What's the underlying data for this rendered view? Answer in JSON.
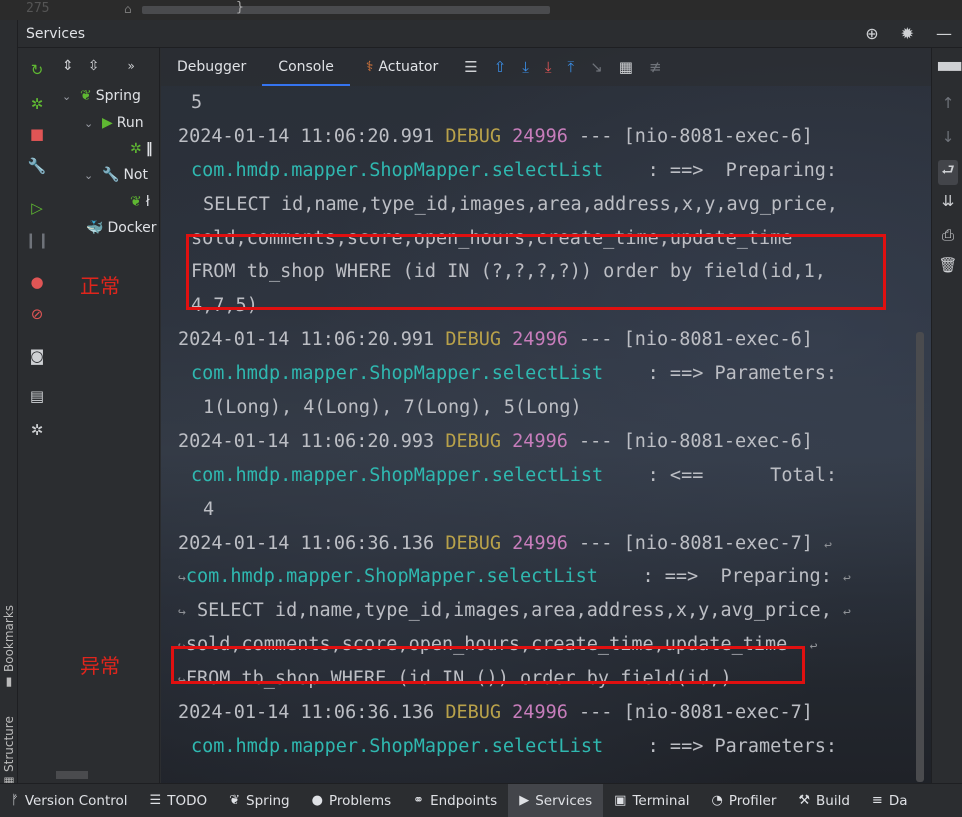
{
  "editor": {
    "line_number": "275",
    "brace": "}"
  },
  "window": {
    "title": "Services"
  },
  "left_stripe": {
    "bookmarks": "Bookmarks",
    "structure": "Structure"
  },
  "tree": {
    "items": [
      {
        "label": "Spring",
        "arrow": "⌄"
      },
      {
        "label": "Run",
        "arrow": "⌄"
      },
      {
        "label": "Not",
        "arrow": "⌄"
      },
      {
        "label": "Docker"
      }
    ]
  },
  "console": {
    "tabs": [
      "Debugger",
      "Console",
      "Actuator"
    ],
    "active_tab": "Console",
    "lines": [
      {
        "indent": "ind",
        "text": "5"
      },
      {
        "ts": "2024-01-14 11:06:20.991",
        "level": "DEBUG",
        "pid": "24996",
        "sep": "---",
        "thread": "[nio-8081-exec-6]"
      },
      {
        "logger": "com.hmdp.mapper.ShopMapper.selectList",
        "msg": "    : ==>  Preparing:"
      },
      {
        "indent": "ind2",
        "text": "SELECT id,name,type_id,images,area,address,x,y,avg_price,"
      },
      {
        "indent": "ind",
        "text": "sold,comments,score,open_hours,create_time,update_time"
      },
      {
        "indent": "ind",
        "text": "FROM tb_shop WHERE (id IN (?,?,?,?)) order by field(id,1,"
      },
      {
        "indent": "ind",
        "text": "4,7,5)"
      },
      {
        "ts": "2024-01-14 11:06:20.991",
        "level": "DEBUG",
        "pid": "24996",
        "sep": "---",
        "thread": "[nio-8081-exec-6]"
      },
      {
        "logger": "com.hmdp.mapper.ShopMapper.selectList",
        "msg": "    : ==> Parameters:"
      },
      {
        "indent": "ind2",
        "text": "1(Long), 4(Long), 7(Long), 5(Long)"
      },
      {
        "ts": "2024-01-14 11:06:20.993",
        "level": "DEBUG",
        "pid": "24996",
        "sep": "---",
        "thread": "[nio-8081-exec-6]"
      },
      {
        "logger": "com.hmdp.mapper.ShopMapper.selectList",
        "msg": "    : <==      Total:"
      },
      {
        "indent": "ind2",
        "text": "4"
      },
      {
        "ts": "2024-01-14 11:06:36.136",
        "level": "DEBUG",
        "pid": "24996",
        "sep": "---",
        "thread": "[nio-8081-exec-7]",
        "wrap_end": "↩"
      },
      {
        "wrap_start": "↪",
        "logger": "com.hmdp.mapper.ShopMapper.selectList",
        "msg": "    : ==>  Preparing:",
        "wrap_end": "↩"
      },
      {
        "wrap_start": "↪",
        "text": " SELECT id,name,type_id,images,area,address,x,y,avg_price,",
        "wrap_end": "↩"
      },
      {
        "wrap_start": "↪",
        "text": "sold,comments,score,open_hours,create_time,update_time ",
        "wrap_end": "↩"
      },
      {
        "wrap_start": "↪",
        "text": "FROM tb_shop WHERE (id IN ()) order by field(id,)"
      },
      {
        "ts": "2024-01-14 11:06:36.136",
        "level": "DEBUG",
        "pid": "24996",
        "sep": "---",
        "thread": "[nio-8081-exec-7]"
      },
      {
        "logger": "com.hmdp.mapper.ShopMapper.selectList",
        "msg": "    : ==> Parameters:"
      }
    ]
  },
  "annotations": {
    "normal": "正常",
    "abnormal": "异常"
  },
  "bottom_bar": {
    "items": [
      {
        "label": "Version Control",
        "icon": "branch-icon",
        "glyph": "ᚠ"
      },
      {
        "label": "TODO",
        "icon": "list-icon",
        "glyph": "☰"
      },
      {
        "label": "Spring",
        "icon": "spring-leaf-icon",
        "glyph": "❦"
      },
      {
        "label": "Problems",
        "icon": "warning-icon",
        "glyph": "●"
      },
      {
        "label": "Endpoints",
        "icon": "endpoints-icon",
        "glyph": "⚭"
      },
      {
        "label": "Services",
        "icon": "services-icon",
        "glyph": "▶",
        "active": true
      },
      {
        "label": "Terminal",
        "icon": "terminal-icon",
        "glyph": "▣"
      },
      {
        "label": "Profiler",
        "icon": "profiler-icon",
        "glyph": "◔"
      },
      {
        "label": "Build",
        "icon": "hammer-icon",
        "glyph": "⚒"
      },
      {
        "label": "Da",
        "icon": "database-icon",
        "glyph": "≡"
      }
    ]
  },
  "colors": {
    "accent": "#3574f0",
    "debug": "#b8a14a",
    "pid": "#c77dbb",
    "logger": "#2fb8b0",
    "highlight": "#e01010"
  }
}
